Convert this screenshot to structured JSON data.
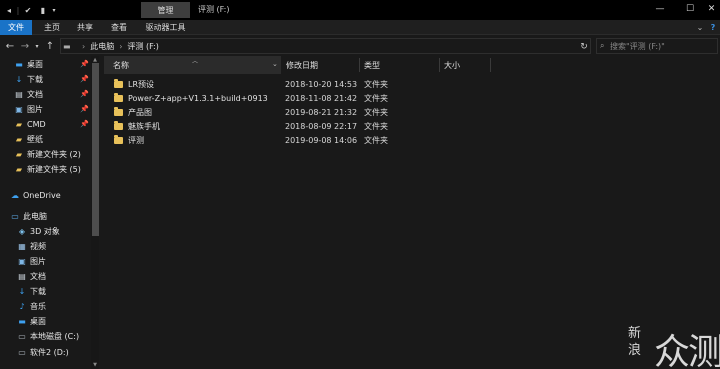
{
  "titlebar": {
    "quick_access": [
      "◂",
      "✔",
      "▮",
      "▾"
    ],
    "context_tab": "管理",
    "title": "评测 (F:)",
    "window_controls": {
      "minimize": "—",
      "maximize": "☐",
      "close": "✕"
    }
  },
  "ribbon": {
    "tabs": [
      "文件",
      "主页",
      "共享",
      "查看",
      "驱动器工具"
    ],
    "expand": "⌄",
    "help": "?"
  },
  "navigation": {
    "back": "←",
    "forward": "→",
    "recent": "▾",
    "up": "↑",
    "breadcrumb": [
      "此电脑",
      "评测 (F:)"
    ],
    "refresh": "↻",
    "search_placeholder": "搜索\"评测 (F:)\""
  },
  "sidebar": {
    "items": [
      {
        "label": "桌面",
        "icon": "desktop-icon",
        "pinned": true
      },
      {
        "label": "下载",
        "icon": "download-icon",
        "pinned": true
      },
      {
        "label": "文档",
        "icon": "document-icon",
        "pinned": true
      },
      {
        "label": "图片",
        "icon": "picture-icon",
        "pinned": true
      },
      {
        "label": "CMD",
        "icon": "folder-icon",
        "pinned": true
      },
      {
        "label": "壁纸",
        "icon": "folder-icon",
        "pinned": false
      },
      {
        "label": "新建文件夹 (2)",
        "icon": "folder-icon",
        "pinned": false
      },
      {
        "label": "新建文件夹 (5)",
        "icon": "folder-icon",
        "pinned": false
      },
      {
        "label": "OneDrive",
        "icon": "cloud-icon",
        "pinned": false
      },
      {
        "label": "此电脑",
        "icon": "computer-icon",
        "pinned": false
      },
      {
        "label": "3D 对象",
        "icon": "cube-icon",
        "pinned": false
      },
      {
        "label": "视频",
        "icon": "video-icon",
        "pinned": false
      },
      {
        "label": "图片",
        "icon": "picture-icon",
        "pinned": false
      },
      {
        "label": "文档",
        "icon": "document-icon",
        "pinned": false
      },
      {
        "label": "下载",
        "icon": "download-icon",
        "pinned": false
      },
      {
        "label": "音乐",
        "icon": "music-icon",
        "pinned": false
      },
      {
        "label": "桌面",
        "icon": "desktop-icon",
        "pinned": false
      },
      {
        "label": "本地磁盘 (C:)",
        "icon": "drive-icon",
        "pinned": false
      },
      {
        "label": "软件2 (D:)",
        "icon": "drive-icon",
        "pinned": false
      }
    ]
  },
  "columns": {
    "name": "名称",
    "date": "修改日期",
    "type": "类型",
    "size": "大小"
  },
  "files": [
    {
      "name": "LR预设",
      "date": "2018-10-20 14:53",
      "type": "文件夹"
    },
    {
      "name": "Power-Z+app+V1.3.1+build+0913",
      "date": "2018-11-08 21:42",
      "type": "文件夹"
    },
    {
      "name": "产品图",
      "date": "2019-08-21 21:32",
      "type": "文件夹"
    },
    {
      "name": "魅族手机",
      "date": "2018-08-09 22:17",
      "type": "文件夹"
    },
    {
      "name": "评测",
      "date": "2019-09-08 14:06",
      "type": "文件夹"
    }
  ],
  "watermark": {
    "side_top": "新",
    "side_bottom": "浪",
    "main_1": "众",
    "main_2": "测"
  },
  "colors": {
    "accent": "#1a73c7",
    "folder": "#e8c15a",
    "background": "#191919"
  }
}
